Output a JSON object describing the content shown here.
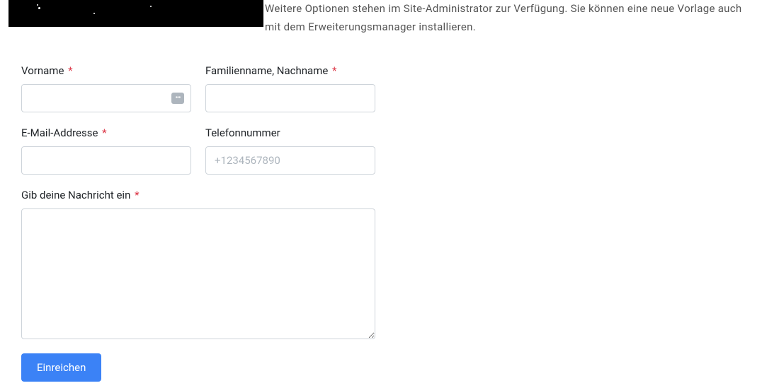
{
  "hero": {
    "description": "Weitere Optionen stehen im Site-Administrator zur Verfügung. Sie können eine neue Vorlage auch mit dem Erweiterungsmanager installieren."
  },
  "form": {
    "firstName": {
      "label": "Vorname",
      "value": ""
    },
    "lastName": {
      "label": "Familienname, Nachname",
      "value": ""
    },
    "email": {
      "label": "E-Mail-Addresse",
      "value": ""
    },
    "phone": {
      "label": "Telefonnummer",
      "placeholder": "+1234567890",
      "value": ""
    },
    "message": {
      "label": "Gib deine Nachricht ein",
      "value": ""
    },
    "submit": {
      "label": "Einreichen"
    }
  }
}
